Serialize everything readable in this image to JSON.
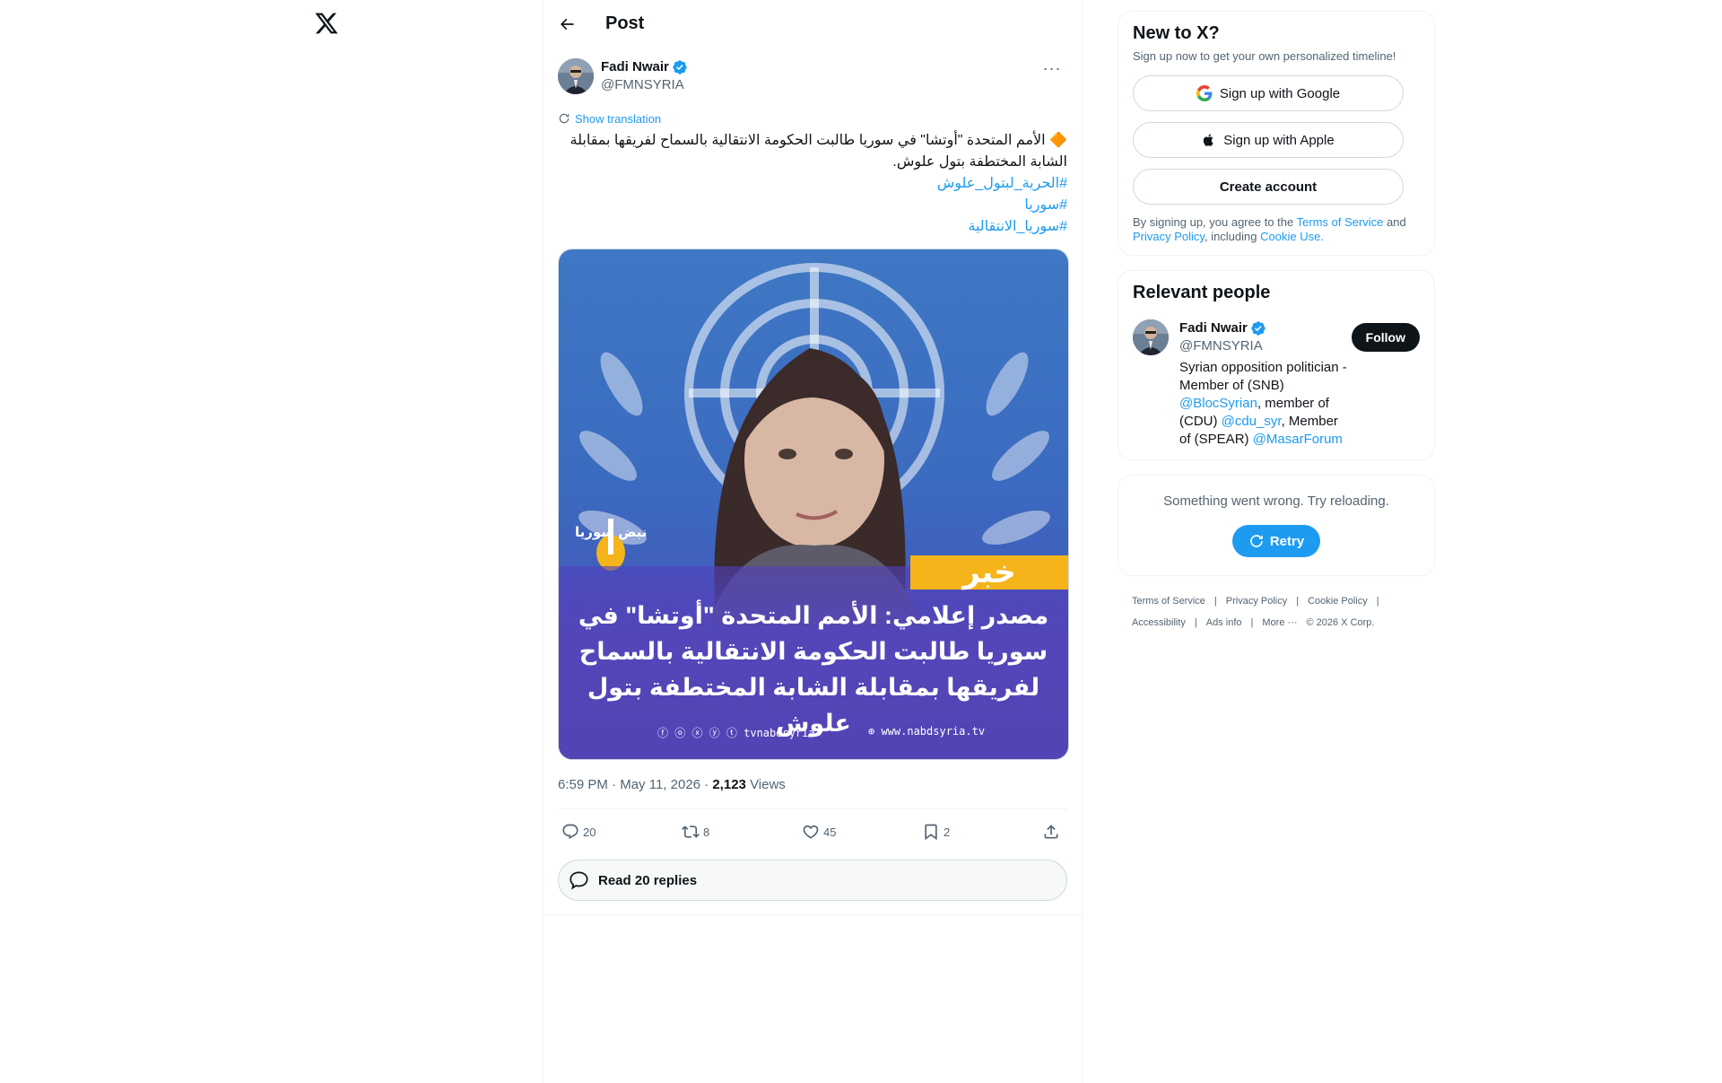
{
  "header": {
    "title": "Post"
  },
  "post": {
    "author_name": "Fadi Nwair",
    "author_handle": "@FMNSYRIA",
    "show_translation": "Show translation",
    "text_main": "🔶 الأمم المتحدة \"أوتشا\" في سوريا طالبت الحكومة الانتقالية بالسماح لفريقها بمقابلة الشابة المختطفة بتول علوش.",
    "hashtags": [
      "#الحرية_لبتول_علوش",
      "#سوريا",
      "#سوريا_الانتقالية"
    ],
    "image": {
      "label": "خبر",
      "headline_line1": "مصدر إعلامي: الأمم المتحدة \"أوتشا\" في",
      "headline_line2": "سوريا طالبت الحكومة الانتقالية بالسماح",
      "headline_line3": "لفريقها بمقابلة الشابة المختطفة بتول علوش",
      "brand": "نبض سوريا",
      "socials": "ⓕ ⓞ ⓧ ⓨ ⓣ tvnabdsyria",
      "website": "⊕ www.nabdsyria.tv"
    },
    "time": "6:59 PM",
    "date": "May 11, 2026",
    "views_count": "2,123",
    "views_label": "Views",
    "dot": "·",
    "replies": "20",
    "reposts": "8",
    "likes": "45",
    "bookmarks": "2",
    "read_replies": "Read 20 replies"
  },
  "signup": {
    "title": "New to X?",
    "subtitle": "Sign up now to get your own personalized timeline!",
    "google": "Sign up with Google",
    "apple": "Sign up with Apple",
    "create": "Create account",
    "legal_prefix": "By signing up, you agree to the ",
    "terms": "Terms of Service",
    "and": " and",
    "privacy": "Privacy Policy",
    "including": ", including ",
    "cookie": "Cookie Use."
  },
  "relevant": {
    "title": "Relevant people",
    "name": "Fadi Nwair",
    "handle": "@FMNSYRIA",
    "follow": "Follow",
    "bio_1": "Syrian opposition politician - Member of (SNB) ",
    "bio_link1": "@BlocSyrian",
    "bio_2": ", member of (CDU) ",
    "bio_link2": "@cdu_syr",
    "bio_3": ", Member of (SPEAR) ",
    "bio_link3": "@MasarForum"
  },
  "error": {
    "message": "Something went wrong. Try reloading.",
    "retry": "Retry"
  },
  "footer": {
    "terms": "Terms of Service",
    "privacy": "Privacy Policy",
    "cookie": "Cookie Policy",
    "accessibility": "Accessibility",
    "ads": "Ads info",
    "more": "More ···",
    "copyright": "© 2026 X Corp.",
    "sep": "|"
  },
  "colors": {
    "accent": "#1d9bf0",
    "text": "#0f1419",
    "muted": "#536471",
    "border": "#eff3f4"
  }
}
